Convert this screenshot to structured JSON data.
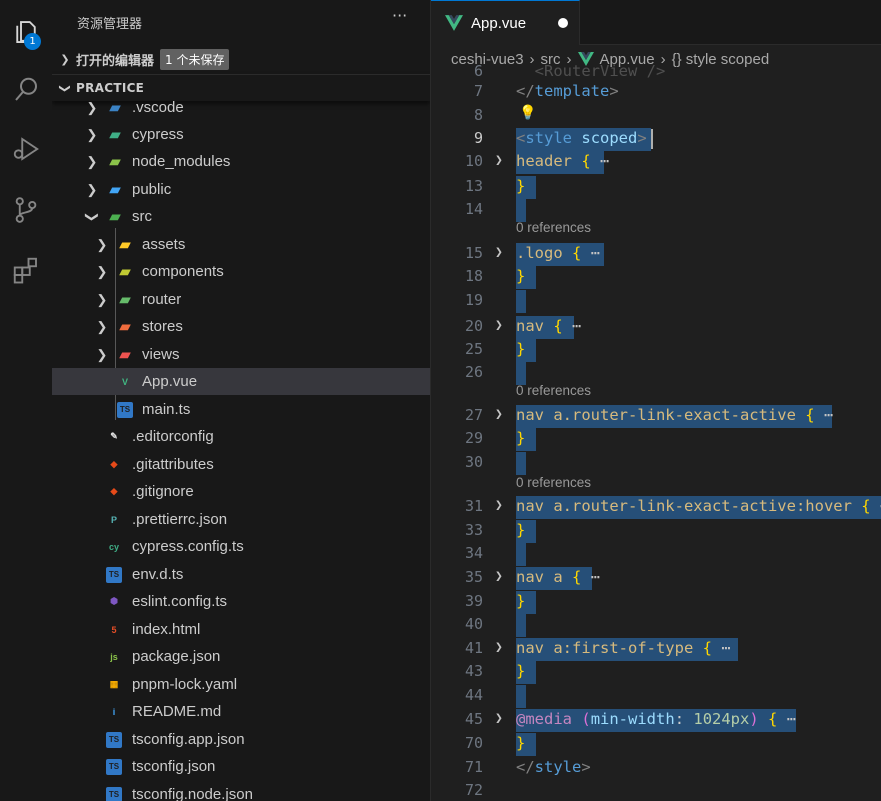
{
  "activity_bar": {
    "items": [
      {
        "name": "explorer-icon",
        "badge": "1"
      },
      {
        "name": "search-icon"
      },
      {
        "name": "run-debug-icon"
      },
      {
        "name": "source-control-icon"
      },
      {
        "name": "extensions-icon"
      }
    ]
  },
  "sidebar": {
    "title": "资源管理器",
    "more": "···",
    "open_editors": {
      "label": "打开的编辑器",
      "unsaved_badge": "1 个未保存"
    },
    "folder": {
      "label": "PRACTICE"
    },
    "items": [
      {
        "label": ".vscode",
        "type": "folder",
        "icon_color": "#3b82c4"
      },
      {
        "label": "cypress",
        "type": "folder",
        "icon_color": "#3fae86"
      },
      {
        "label": "node_modules",
        "type": "folder",
        "icon_color": "#8bc34a"
      },
      {
        "label": "public",
        "type": "folder",
        "icon_color": "#42a5f5"
      },
      {
        "label": "src",
        "type": "folder-open",
        "icon_color": "#4caf50"
      },
      {
        "label": "assets",
        "type": "folder",
        "icon_color": "#ffca28"
      },
      {
        "label": "components",
        "type": "folder",
        "icon_color": "#c0ca33"
      },
      {
        "label": "router",
        "type": "folder",
        "icon_color": "#66bb6a"
      },
      {
        "label": "stores",
        "type": "folder",
        "icon_color": "#ef6c3d"
      },
      {
        "label": "views",
        "type": "folder",
        "icon_color": "#ef5350"
      },
      {
        "label": "App.vue",
        "type": "vue",
        "icon_color": "#41b883"
      },
      {
        "label": "main.ts",
        "type": "ts",
        "icon_color": "#3178c6"
      },
      {
        "label": ".editorconfig",
        "type": "editorconfig",
        "icon_color": "#e0e0e0"
      },
      {
        "label": ".gitattributes",
        "type": "git",
        "icon_color": "#e64a19"
      },
      {
        "label": ".gitignore",
        "type": "git",
        "icon_color": "#e64a19"
      },
      {
        "label": ".prettierrc.json",
        "type": "prettier",
        "icon_color": "#56b3b4"
      },
      {
        "label": "cypress.config.ts",
        "type": "cypress",
        "icon_color": "#3fae86"
      },
      {
        "label": "env.d.ts",
        "type": "ts",
        "icon_color": "#3178c6"
      },
      {
        "label": "eslint.config.ts",
        "type": "eslint",
        "icon_color": "#7e57c2"
      },
      {
        "label": "index.html",
        "type": "html",
        "icon_color": "#e44d26"
      },
      {
        "label": "package.json",
        "type": "node",
        "icon_color": "#8bc34a"
      },
      {
        "label": "pnpm-lock.yaml",
        "type": "pnpm",
        "icon_color": "#f9ad00"
      },
      {
        "label": "README.md",
        "type": "info",
        "icon_color": "#42a5f5"
      },
      {
        "label": "tsconfig.app.json",
        "type": "tsconfig",
        "icon_color": "#3178c6"
      },
      {
        "label": "tsconfig.json",
        "type": "tsconfig",
        "icon_color": "#3178c6"
      },
      {
        "label": "tsconfig.node.json",
        "type": "tsconfig",
        "icon_color": "#3178c6"
      }
    ]
  },
  "editor": {
    "tab": {
      "label": "App.vue",
      "modified": true
    },
    "breadcrumb": [
      "ceshi-vue3",
      "src",
      "App.vue",
      "{} style scoped"
    ],
    "references_label": "0 references",
    "fold_dots": "⋯",
    "lines": [
      {
        "n": "6",
        "code": "  <RouterView />"
      },
      {
        "n": "7",
        "code": "</template>"
      },
      {
        "n": "8",
        "code": ""
      },
      {
        "n": "9",
        "code": "<style scoped>"
      },
      {
        "n": "10",
        "code": "header {"
      },
      {
        "n": "13",
        "code": "}"
      },
      {
        "n": "14",
        "code": ""
      },
      {
        "n": "15",
        "code": ".logo {"
      },
      {
        "n": "18",
        "code": "}"
      },
      {
        "n": "19",
        "code": ""
      },
      {
        "n": "20",
        "code": "nav {"
      },
      {
        "n": "25",
        "code": "}"
      },
      {
        "n": "26",
        "code": ""
      },
      {
        "n": "27",
        "code": "nav a.router-link-exact-active {"
      },
      {
        "n": "29",
        "code": "}"
      },
      {
        "n": "30",
        "code": ""
      },
      {
        "n": "31",
        "code": "nav a.router-link-exact-active:hover {"
      },
      {
        "n": "33",
        "code": "}"
      },
      {
        "n": "34",
        "code": ""
      },
      {
        "n": "35",
        "code": "nav a {"
      },
      {
        "n": "39",
        "code": "}"
      },
      {
        "n": "40",
        "code": ""
      },
      {
        "n": "41",
        "code": "nav a:first-of-type {"
      },
      {
        "n": "43",
        "code": "}"
      },
      {
        "n": "44",
        "code": ""
      },
      {
        "n": "45",
        "code": "@media (min-width: 1024px) {"
      },
      {
        "n": "70",
        "code": "}"
      },
      {
        "n": "71",
        "code": "</style>"
      },
      {
        "n": "72",
        "code": ""
      }
    ]
  },
  "colors": {
    "accent": "#0078d4",
    "selection": "#264f78"
  }
}
